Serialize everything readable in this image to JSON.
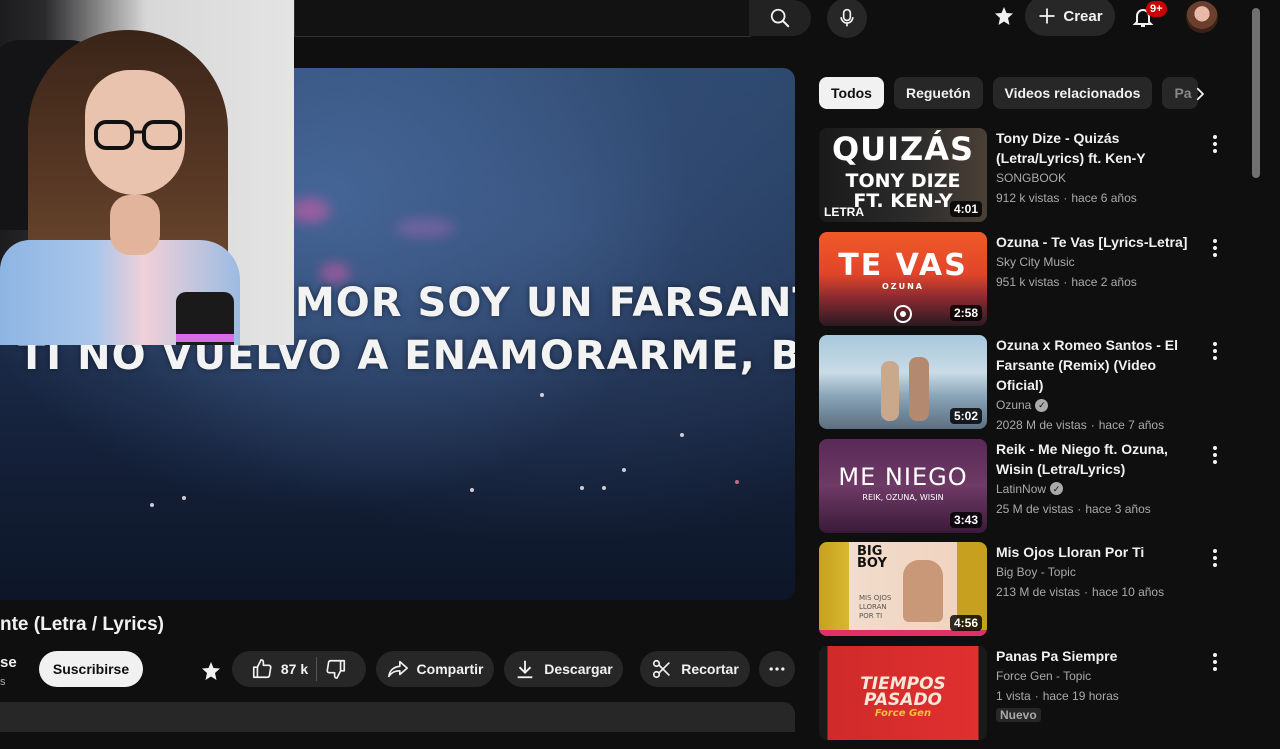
{
  "header": {
    "create_label": "Crear",
    "notif_count": "9+"
  },
  "player": {
    "lyric_line1": "MOR SOY UN FARSANTE",
    "lyric_line2": "TI NO VUELVO A ENAMORARME, BEBÉ"
  },
  "video": {
    "title": "nte (Letra / Lyrics)",
    "channel_fragment": "se",
    "subscribers_fragment": "s",
    "subscribe_label": "Suscribirse",
    "like_count": "87 k",
    "share_label": "Compartir",
    "download_label": "Descargar",
    "clip_label": "Recortar"
  },
  "chips": [
    "Todos",
    "Reguetón",
    "Videos relacionados",
    "Pa"
  ],
  "recommendations": [
    {
      "title": "Tony Dize - Quizás (Letra/Lyrics) ft. Ken-Y",
      "channel": "SONGBOOK",
      "views": "912 k vistas",
      "age": "hace 6 años",
      "duration": "4:01",
      "thumb_text": [
        "QUIZÁS",
        "TONY DIZE",
        "FT. KEN-Y",
        "LETRA"
      ]
    },
    {
      "title": "Ozuna - Te Vas [Lyrics-Letra]",
      "channel": "Sky City Music",
      "views": "951 k vistas",
      "age": "hace 2 años",
      "duration": "2:58",
      "thumb_text": [
        "TE VAS",
        "OZUNA"
      ]
    },
    {
      "title": "Ozuna x Romeo Santos - El Farsante (Remix) (Video Oficial)",
      "channel": "Ozuna",
      "verified": true,
      "views": "2028 M de vistas",
      "age": "hace 7 años",
      "duration": "5:02"
    },
    {
      "title": "Reik - Me Niego ft. Ozuna, Wisin (Letra/Lyrics)",
      "channel": "LatinNow",
      "verified": true,
      "views": "25 M de vistas",
      "age": "hace 3 años",
      "duration": "3:43",
      "thumb_text": [
        "ME NIEGO",
        "REIK, OZUNA, WISIN"
      ]
    },
    {
      "title": "Mis Ojos Lloran Por Ti",
      "channel": "Big Boy - Topic",
      "views": "213 M de vistas",
      "age": "hace 10 años",
      "duration": "4:56",
      "thumb_text": [
        "BIG",
        "BOY",
        "MIS OJOS LLORAN POR TI"
      ]
    },
    {
      "title": "Panas Pa Siempre",
      "channel": "Force Gen - Topic",
      "views": "1 vista",
      "age": "hace 19 horas",
      "badge": "Nuevo",
      "thumb_text": [
        "TIEMPOS",
        "PASADO",
        "Force Gen"
      ]
    }
  ]
}
